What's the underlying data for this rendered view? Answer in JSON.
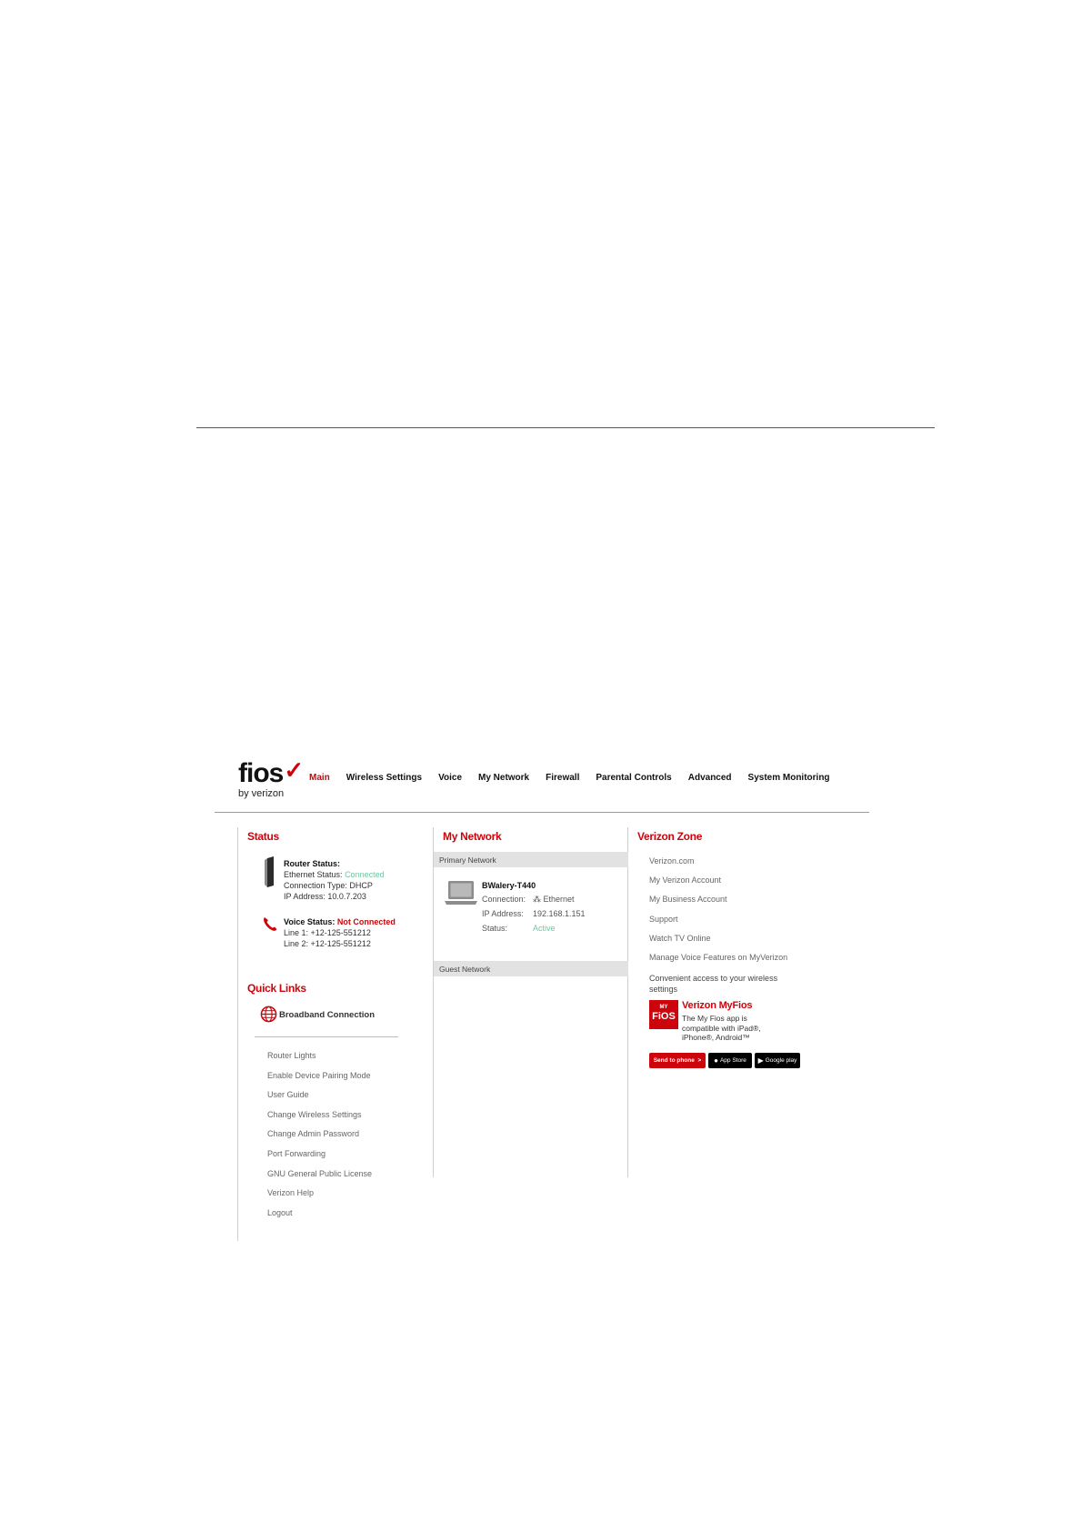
{
  "brand": {
    "wordmark": "fios",
    "byline": "by verizon",
    "accent": "#cd040b"
  },
  "nav": [
    {
      "label": "Main",
      "active": true
    },
    {
      "label": "Wireless Settings"
    },
    {
      "label": "Voice"
    },
    {
      "label": "My Network"
    },
    {
      "label": "Firewall"
    },
    {
      "label": "Parental Controls"
    },
    {
      "label": "Advanced"
    },
    {
      "label": "System Monitoring"
    }
  ],
  "status": {
    "title": "Status",
    "router": {
      "label": "Router Status:",
      "ethernet_label": "Ethernet Status:",
      "ethernet_value": "Connected",
      "connection_type": "Connection Type: DHCP",
      "ip": "IP Address: 10.0.7.203"
    },
    "voice": {
      "label": "Voice Status:",
      "value": "Not Connected",
      "line1": "Line 1: +12-125-551212",
      "line2": "Line 2: +12-125-551212"
    }
  },
  "quick_links": {
    "title": "Quick Links",
    "primary": "Broadband Connection",
    "items": [
      "Router Lights",
      "Enable Device Pairing Mode",
      "User Guide",
      "Change Wireless Settings",
      "Change Admin Password",
      "Port Forwarding",
      "GNU General Public License",
      "Verizon Help",
      "Logout"
    ]
  },
  "my_network": {
    "title": "My Network",
    "primary_label": "Primary Network",
    "guest_label": "Guest Network",
    "device": {
      "name": "BWalery-T440",
      "connection_label": "Connection:",
      "connection_value": "Ethernet",
      "ip_label": "IP Address:",
      "ip_value": "192.168.1.151",
      "status_label": "Status:",
      "status_value": "Active"
    }
  },
  "verizon_zone": {
    "title": "Verizon Zone",
    "links": [
      "Verizon.com",
      "My Verizon Account",
      "My Business Account",
      "Support",
      "Watch TV Online",
      "Manage Voice Features on MyVerizon"
    ],
    "note": "Convenient access to your wireless settings",
    "app": {
      "logo_top": "MY",
      "logo_bottom": "FiOS",
      "title": "Verizon MyFios",
      "description": "The My Fios app is compatible with iPad®, iPhone®, Android™"
    },
    "badges": {
      "send": "Send to phone",
      "send_chevron": ">",
      "apple": "App Store",
      "google": "Google play"
    }
  }
}
